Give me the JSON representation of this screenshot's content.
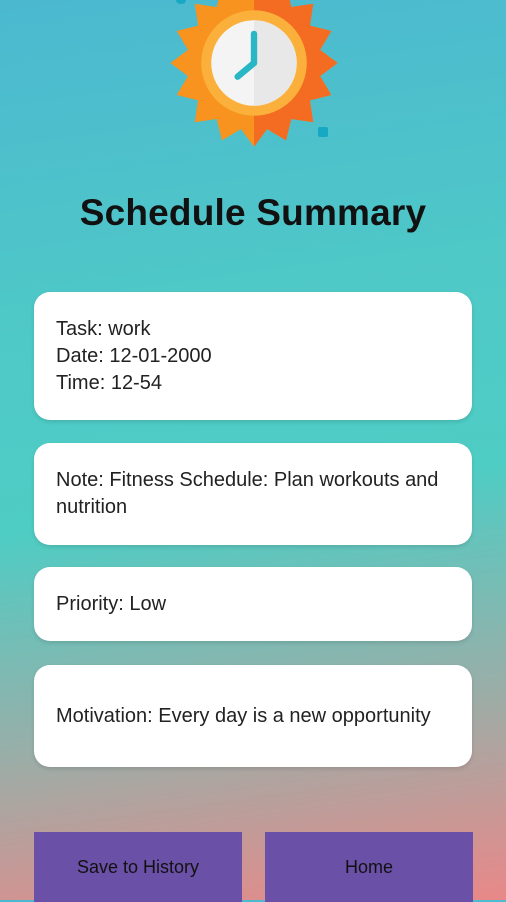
{
  "page": {
    "title": "Schedule Summary"
  },
  "summary": {
    "task": "Task: work",
    "date": "Date: 12-01-2000",
    "time": "Time: 12-54",
    "note": "Note: Fitness Schedule: Plan workouts and nutrition",
    "priority": "Priority: Low",
    "motivation": "Motivation: Every day is a new opportunity"
  },
  "actions": {
    "save_label": "Save to History",
    "home_label": "Home"
  },
  "icons": {
    "hero": "sun-clock-icon"
  },
  "colors": {
    "button": "#6a50a7",
    "card": "#ffffff",
    "sun_orange": "#f7931e",
    "sun_dark": "#f26522",
    "clock_hands": "#29b6c5"
  }
}
